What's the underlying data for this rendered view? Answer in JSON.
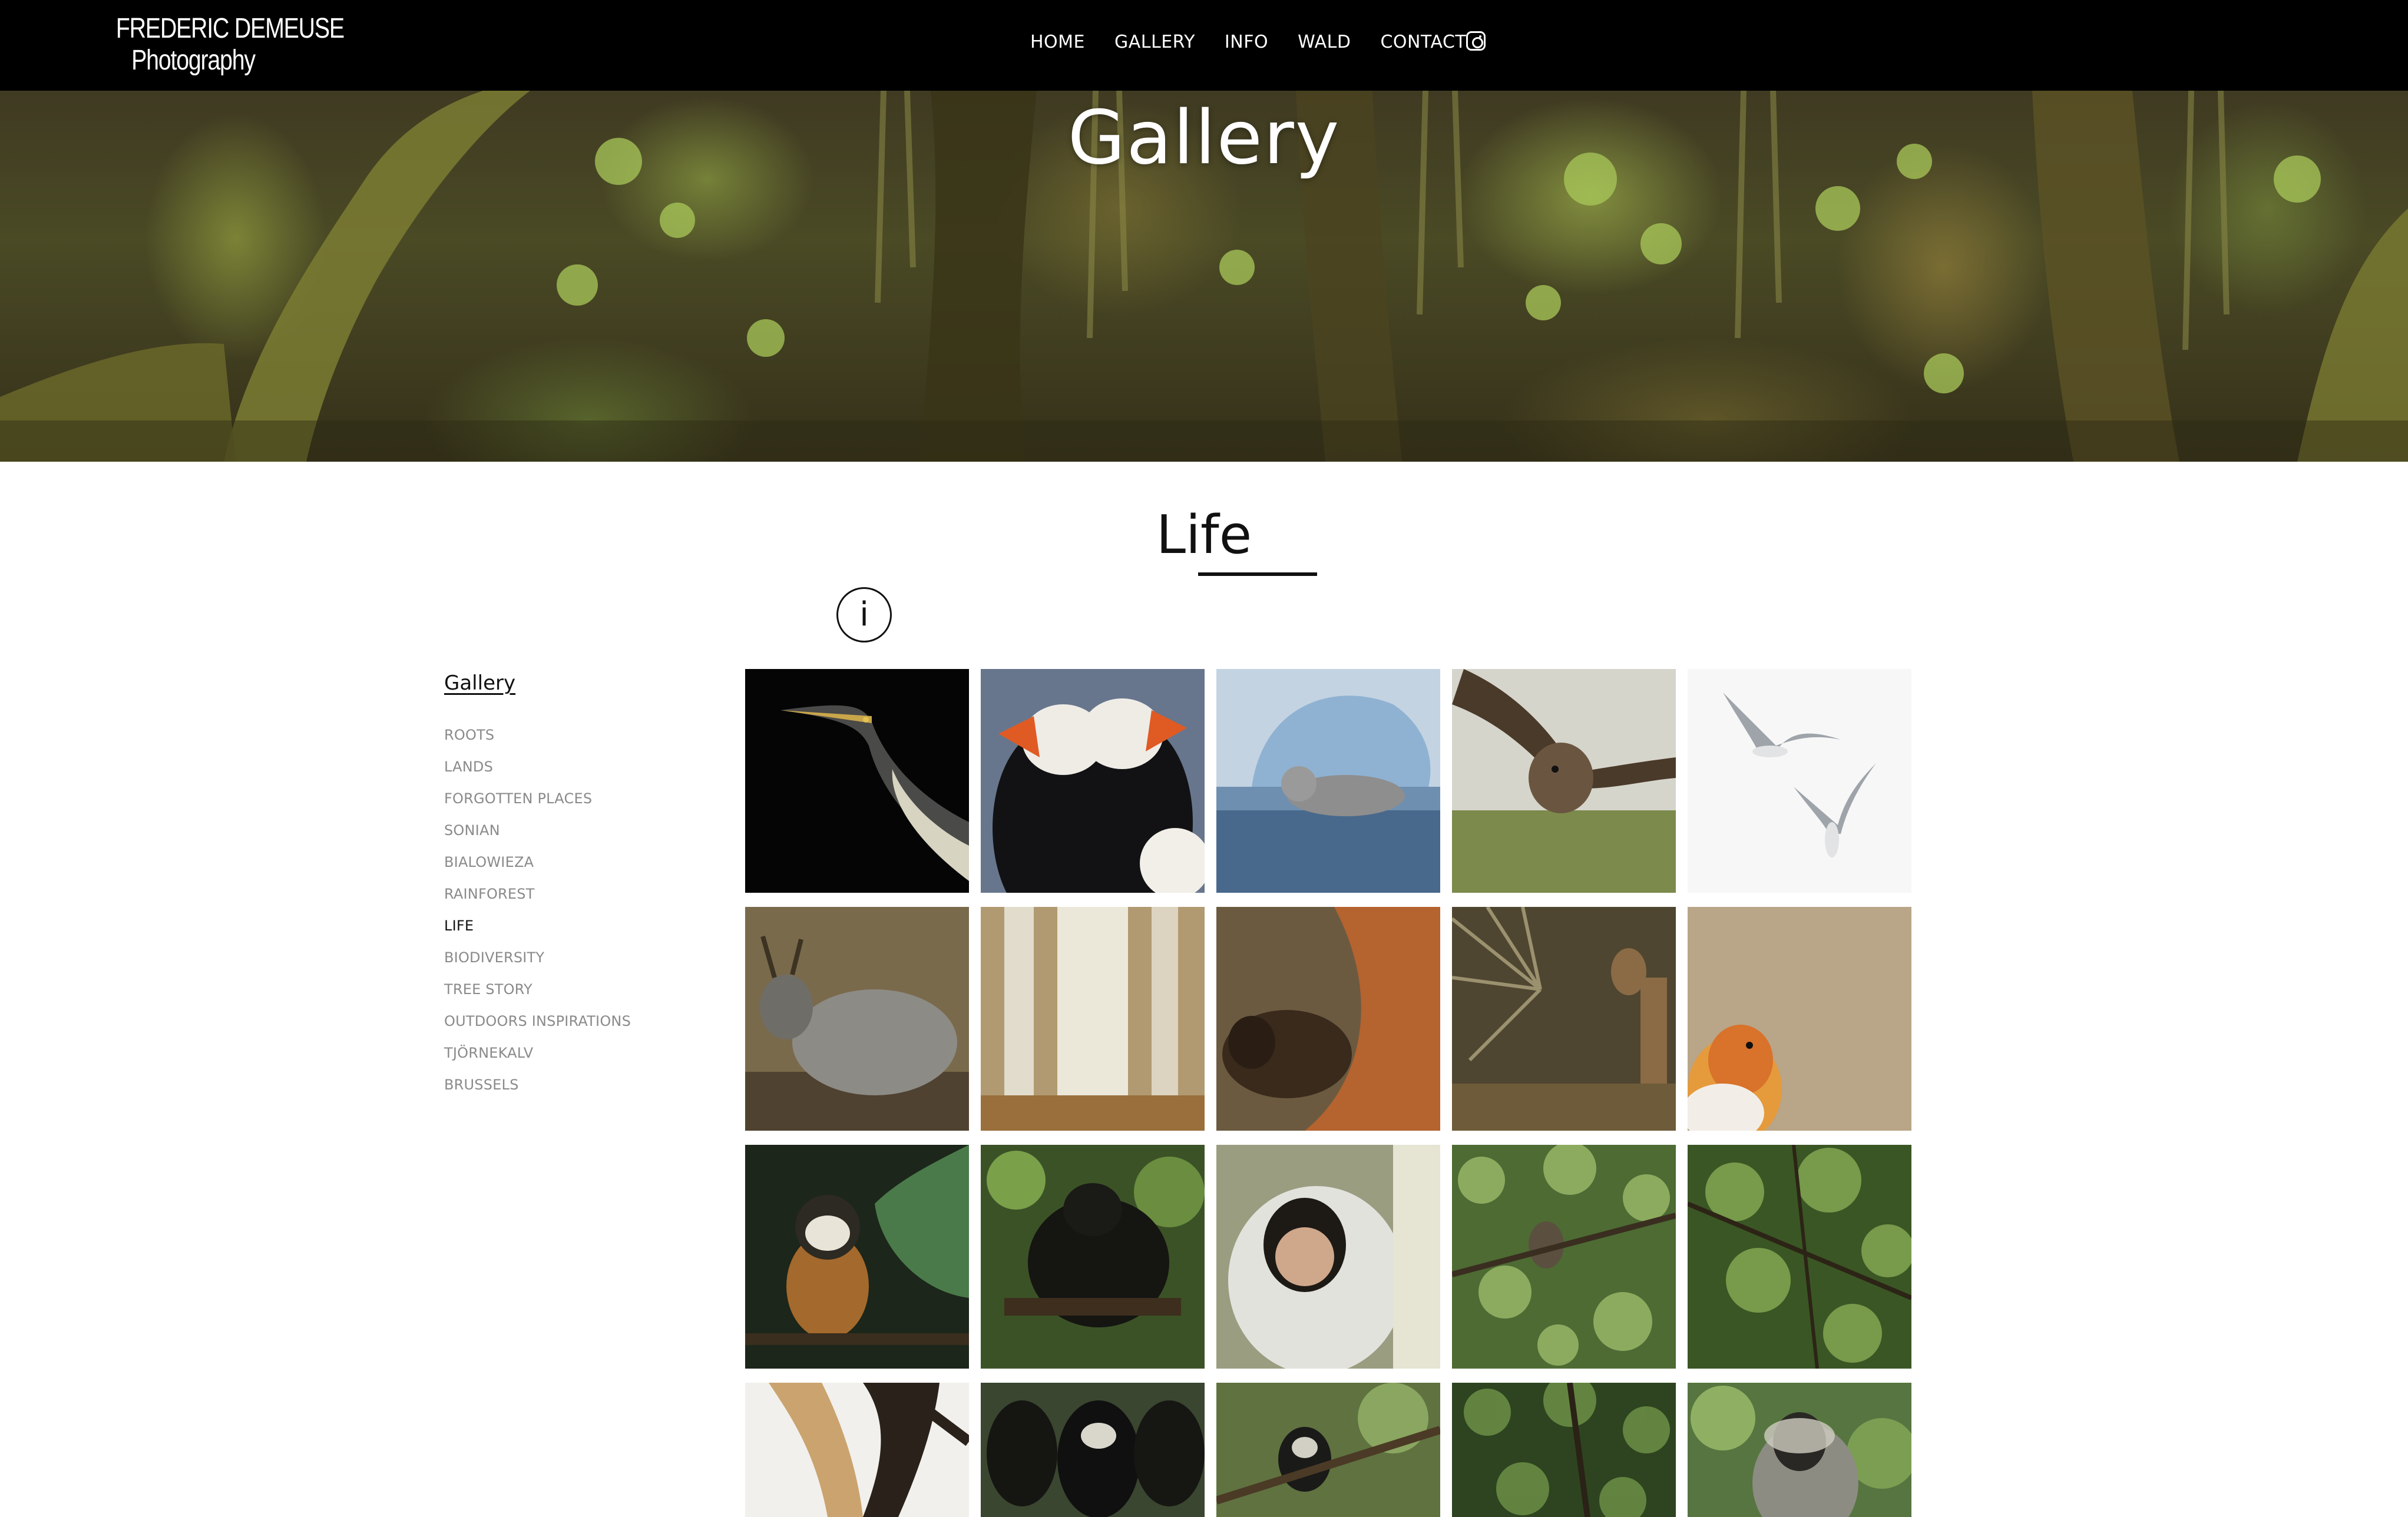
{
  "header": {
    "logo_line1": "FREDERIC DEMEUSE",
    "logo_line2": "Photography",
    "nav": [
      {
        "label": "HOME"
      },
      {
        "label": "GALLERY"
      },
      {
        "label": "INFO"
      },
      {
        "label": "WALD"
      },
      {
        "label": "CONTACT"
      }
    ],
    "instagram_icon": "instagram-icon"
  },
  "hero": {
    "title": "Gallery"
  },
  "section": {
    "title": "Life",
    "info_label": "i"
  },
  "sidebar": {
    "title": "Gallery",
    "items": [
      {
        "label": "ROOTS"
      },
      {
        "label": "LANDS"
      },
      {
        "label": "FORGOTTEN PLACES"
      },
      {
        "label": "SONIAN"
      },
      {
        "label": "BIALOWIEZA"
      },
      {
        "label": "RAINFOREST"
      },
      {
        "label": "LIFE",
        "active": true
      },
      {
        "label": "BIODIVERSITY"
      },
      {
        "label": "TREE STORY"
      },
      {
        "label": "OUTDOORS INSPIRATIONS"
      },
      {
        "label": "TJÖRNEKALV"
      },
      {
        "label": "BRUSSELS"
      }
    ]
  },
  "gallery": {
    "thumbnails": [
      {
        "subject": "heron"
      },
      {
        "subject": "puffins"
      },
      {
        "subject": "seal"
      },
      {
        "subject": "skua"
      },
      {
        "subject": "terns"
      },
      {
        "subject": "deer"
      },
      {
        "subject": "birch-trunks"
      },
      {
        "subject": "bison"
      },
      {
        "subject": "antelope"
      },
      {
        "subject": "robin"
      },
      {
        "subject": "squirrel-monkey"
      },
      {
        "subject": "chimpanzee"
      },
      {
        "subject": "capuchin"
      },
      {
        "subject": "monkey-in-foliage"
      },
      {
        "subject": "jungle-canopy"
      },
      {
        "subject": "gibbon"
      },
      {
        "subject": "colobus-group"
      },
      {
        "subject": "monkey-on-branch"
      },
      {
        "subject": "monkey-in-trees"
      },
      {
        "subject": "vervet-monkey"
      }
    ]
  },
  "colors": {
    "nav_background": "#000000",
    "text_dark": "#111111",
    "sidebar_text": "#8a8a8a"
  }
}
